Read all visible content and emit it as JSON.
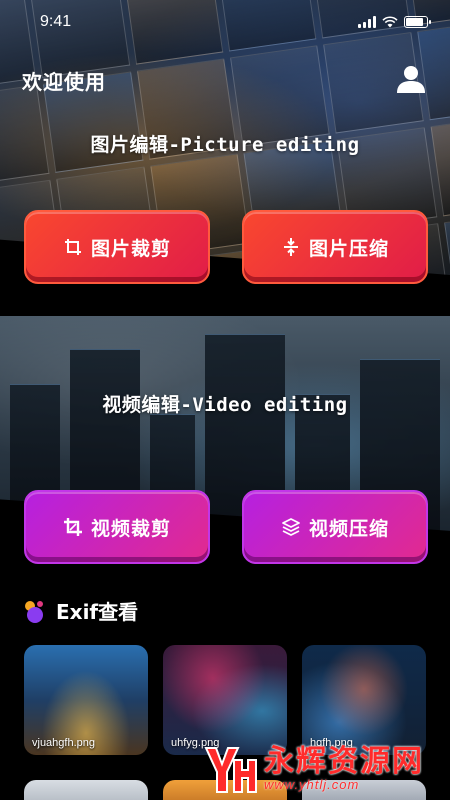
{
  "status_bar": {
    "time": "9:41"
  },
  "picture_section": {
    "welcome": "欢迎使用",
    "title": "图片编辑-Picture editing",
    "buttons": [
      {
        "label": "图片裁剪",
        "icon": "crop-icon"
      },
      {
        "label": "图片压缩",
        "icon": "compress-icon"
      }
    ]
  },
  "video_section": {
    "title": "视频编辑-Video editing",
    "buttons": [
      {
        "label": "视频裁剪",
        "icon": "crop-icon"
      },
      {
        "label": "视频压缩",
        "icon": "layers-icon"
      }
    ]
  },
  "exif": {
    "title": "Exif查看",
    "images": [
      {
        "name": "vjuahgfh.png"
      },
      {
        "name": "uhfyg.png"
      },
      {
        "name": "hgfh.png"
      }
    ]
  },
  "watermark": {
    "title": "永辉资源网",
    "url": "www.yhtlj.com"
  },
  "colors": {
    "red_button": "#f9472f",
    "pink_button": "#e11d48",
    "purple_button": "#b620e0",
    "magenta_button": "#e22a8f",
    "background": "#000000",
    "watermark_red": "#ff2b2b"
  }
}
